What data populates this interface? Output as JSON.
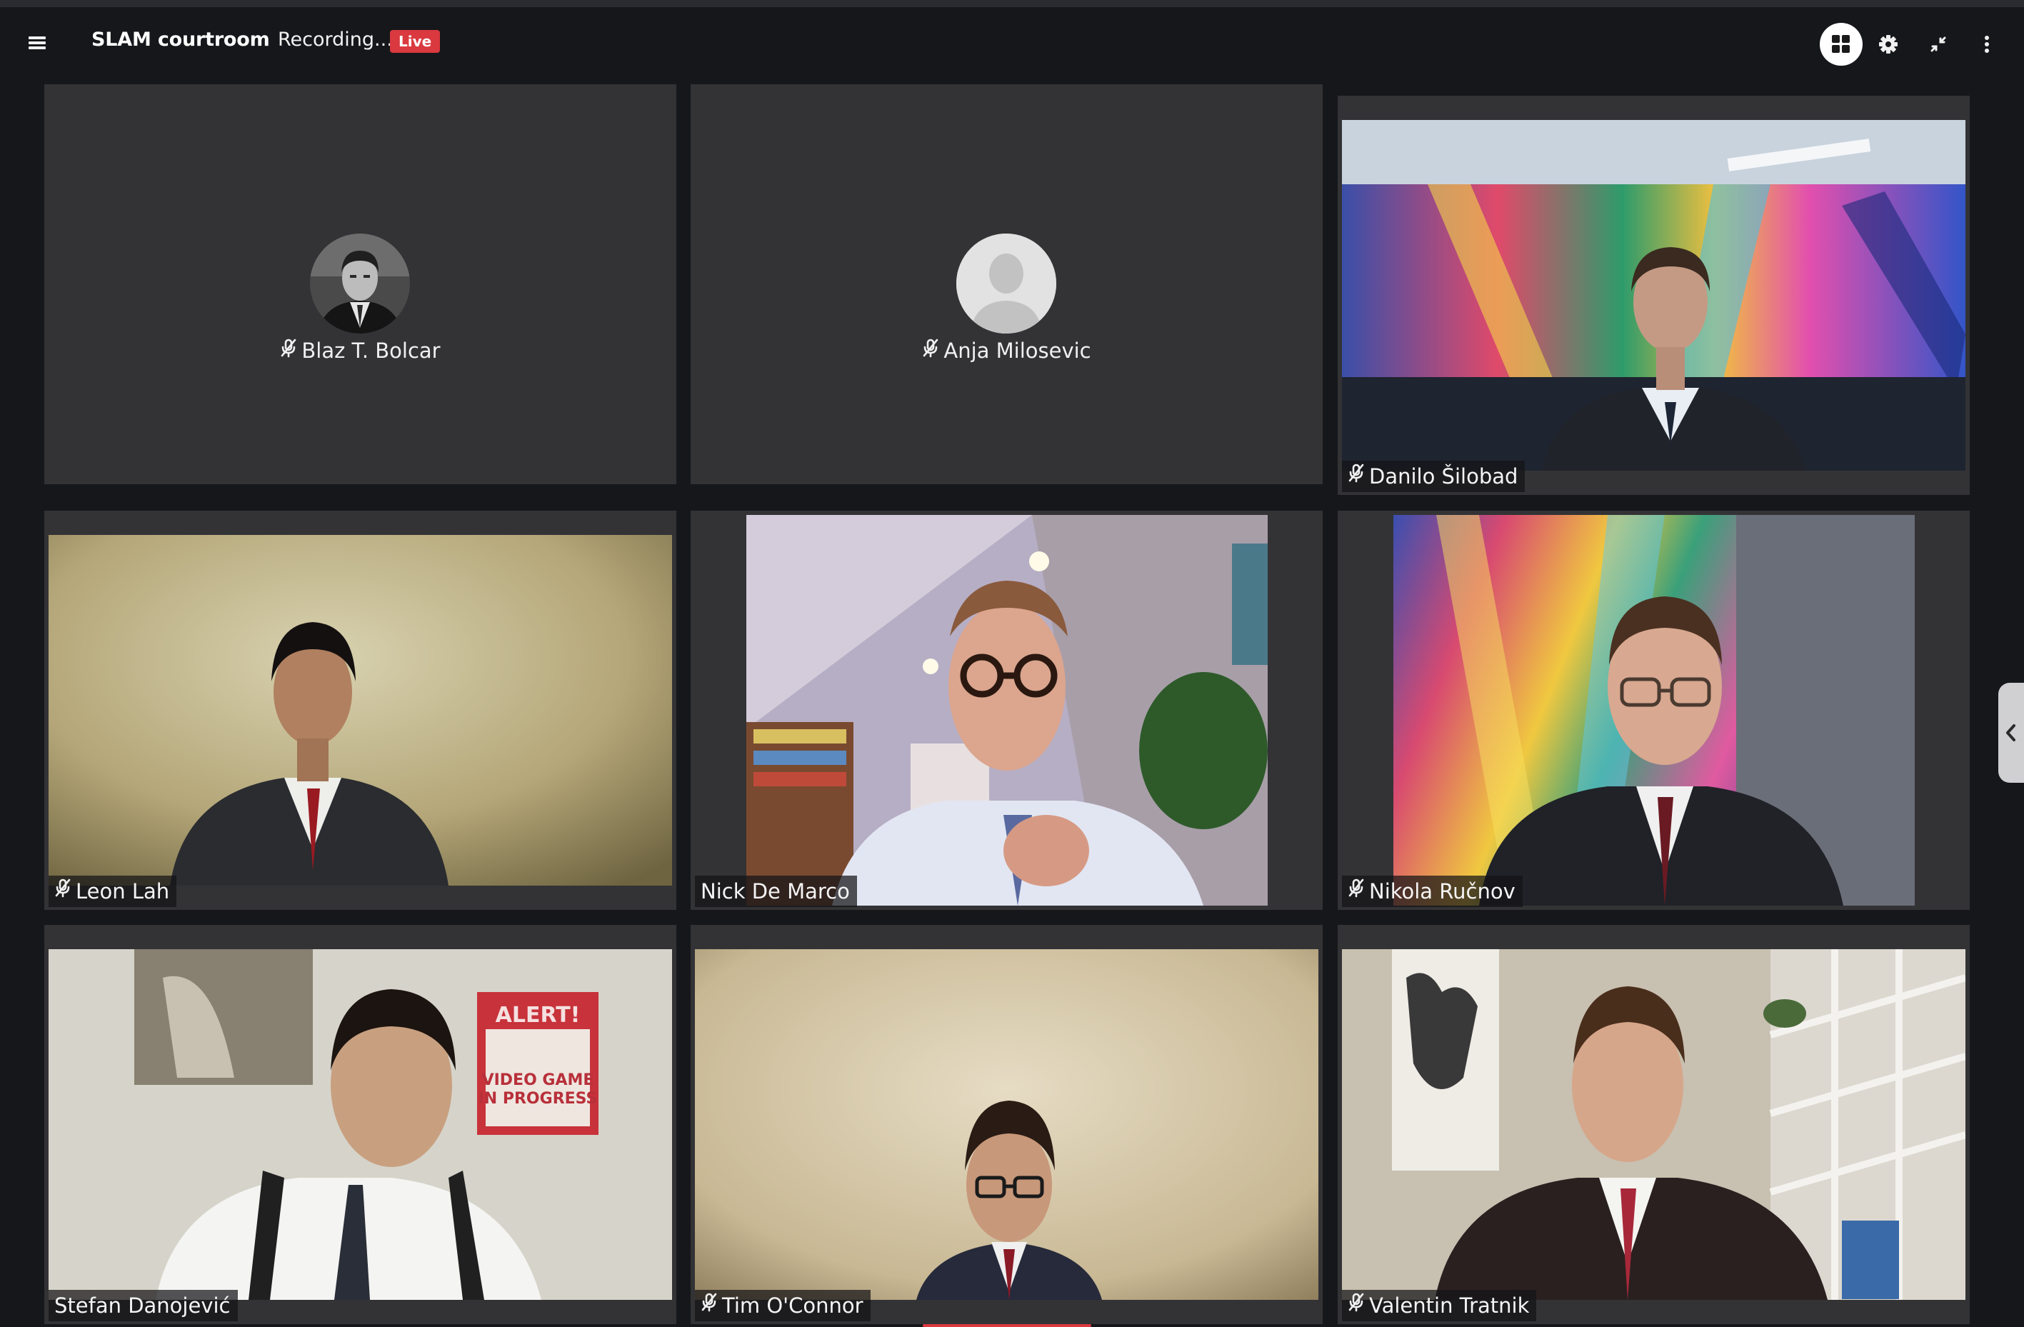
{
  "header": {
    "menu_icon": "hamburger-menu-icon",
    "room_title": "SLAM courtroom",
    "recording_text": "Recording...",
    "live_badge": "Live",
    "controls": [
      "grid-layout-icon",
      "gear-icon",
      "minimize-arrows-icon",
      "more-vertical-icon"
    ]
  },
  "colors": {
    "background": "#16171b",
    "tile": "#333336",
    "live_badge": "#d9393f",
    "label_background": "rgba(20,20,22,0.72)"
  },
  "participants": [
    {
      "name": "Blaz T. Bolcar",
      "muted": true,
      "video": false,
      "avatar": "photo-avatar"
    },
    {
      "name": "Anja Milosevic",
      "muted": true,
      "video": false,
      "avatar": "default-person-avatar"
    },
    {
      "name": "Danilo Šilobad",
      "muted": true,
      "video": true
    },
    {
      "name": "Leon Lah",
      "muted": true,
      "video": true
    },
    {
      "name": "Nick De Marco",
      "muted": false,
      "video": true
    },
    {
      "name": "Nikola Ručnov",
      "muted": true,
      "video": true
    },
    {
      "name": "Stefan Danojević",
      "muted": false,
      "video": true
    },
    {
      "name": "Tim O'Connor",
      "muted": true,
      "video": true
    },
    {
      "name": "Valentin Tratnik",
      "muted": true,
      "video": true
    }
  ],
  "side_panel_toggle_icon": "chevron-left-icon"
}
